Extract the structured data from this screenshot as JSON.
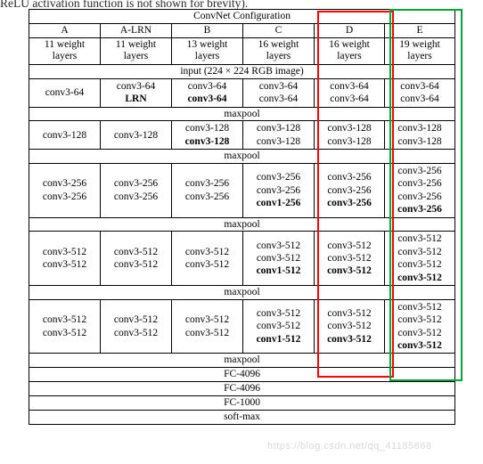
{
  "page": {
    "cutoff_text_top": "ReLU activation function is not shown for brevity)."
  },
  "table": {
    "title": "ConvNet Configuration",
    "columns": [
      "A",
      "A-LRN",
      "B",
      "C",
      "D",
      "E"
    ],
    "weights_row": [
      {
        "l1": "11 weight",
        "l2": "layers"
      },
      {
        "l1": "11 weight",
        "l2": "layers"
      },
      {
        "l1": "13 weight",
        "l2": "layers"
      },
      {
        "l1": "16 weight",
        "l2": "layers"
      },
      {
        "l1": "16 weight",
        "l2": "layers"
      },
      {
        "l1": "19 weight",
        "l2": "layers"
      }
    ],
    "input_row": "input (224 × 224 RGB image)",
    "maxpool_label": "maxpool",
    "blocks": [
      {
        "A": [
          "conv3-64"
        ],
        "ALRN": [
          "conv3-64",
          "LRN"
        ],
        "B": [
          "conv3-64",
          "conv3-64"
        ],
        "C": [
          "conv3-64",
          "conv3-64"
        ],
        "D": [
          "conv3-64",
          "conv3-64"
        ],
        "E": [
          "conv3-64",
          "conv3-64"
        ],
        "bold": {
          "ALRN": [
            1
          ],
          "B": [
            1
          ]
        }
      },
      {
        "A": [
          "conv3-128"
        ],
        "ALRN": [
          "conv3-128"
        ],
        "B": [
          "conv3-128",
          "conv3-128"
        ],
        "C": [
          "conv3-128",
          "conv3-128"
        ],
        "D": [
          "conv3-128",
          "conv3-128"
        ],
        "E": [
          "conv3-128",
          "conv3-128"
        ],
        "bold": {
          "B": [
            1
          ]
        }
      },
      {
        "A": [
          "conv3-256",
          "conv3-256"
        ],
        "ALRN": [
          "conv3-256",
          "conv3-256"
        ],
        "B": [
          "conv3-256",
          "conv3-256"
        ],
        "C": [
          "conv3-256",
          "conv3-256",
          "conv1-256"
        ],
        "D": [
          "conv3-256",
          "conv3-256",
          "conv3-256"
        ],
        "E": [
          "conv3-256",
          "conv3-256",
          "conv3-256",
          "conv3-256"
        ],
        "bold": {
          "C": [
            2
          ],
          "D": [
            2
          ],
          "E": [
            3
          ]
        }
      },
      {
        "A": [
          "conv3-512",
          "conv3-512"
        ],
        "ALRN": [
          "conv3-512",
          "conv3-512"
        ],
        "B": [
          "conv3-512",
          "conv3-512"
        ],
        "C": [
          "conv3-512",
          "conv3-512",
          "conv1-512"
        ],
        "D": [
          "conv3-512",
          "conv3-512",
          "conv3-512"
        ],
        "E": [
          "conv3-512",
          "conv3-512",
          "conv3-512",
          "conv3-512"
        ],
        "bold": {
          "C": [
            2
          ],
          "D": [
            2
          ],
          "E": [
            3
          ]
        }
      },
      {
        "A": [
          "conv3-512",
          "conv3-512"
        ],
        "ALRN": [
          "conv3-512",
          "conv3-512"
        ],
        "B": [
          "conv3-512",
          "conv3-512"
        ],
        "C": [
          "conv3-512",
          "conv3-512",
          "conv1-512"
        ],
        "D": [
          "conv3-512",
          "conv3-512",
          "conv3-512"
        ],
        "E": [
          "conv3-512",
          "conv3-512",
          "conv3-512",
          "conv3-512"
        ],
        "bold": {
          "C": [
            2
          ],
          "D": [
            2
          ],
          "E": [
            3
          ]
        }
      }
    ],
    "footer_rows": [
      "maxpool",
      "FC-4096",
      "FC-4096",
      "FC-1000",
      "soft-max"
    ]
  },
  "annotations": {
    "highlight_d": {
      "color": "#ff0000",
      "label": "red-box-column-d"
    },
    "highlight_e": {
      "color": "#00a53c",
      "label": "green-box-column-e"
    }
  },
  "watermark": {
    "text": "https://blog.csdn.net/qq_41185868"
  }
}
